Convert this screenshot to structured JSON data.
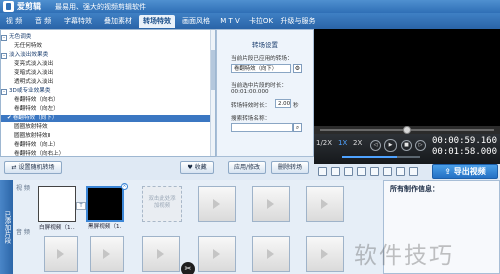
{
  "app": {
    "title": "爱剪辑",
    "slogan": "最易用、强大的视频剪辑软件"
  },
  "tabs": [
    {
      "label": "视 频",
      "active": false
    },
    {
      "label": "音 频",
      "active": false
    },
    {
      "label": "字幕特效",
      "active": false
    },
    {
      "label": "叠加素材",
      "active": false
    },
    {
      "label": "转场特效",
      "active": true
    },
    {
      "label": "画面风格",
      "active": false
    },
    {
      "label": "M T V",
      "active": false
    },
    {
      "label": "卡拉OK",
      "active": false
    },
    {
      "label": "升级与服务",
      "active": false
    }
  ],
  "tree": [
    {
      "label": "无色调类",
      "type": "group"
    },
    {
      "label": "无任何特效",
      "type": "item"
    },
    {
      "label": "淡入淡出效果类",
      "type": "group"
    },
    {
      "label": "变亮式淡入淡出",
      "type": "item"
    },
    {
      "label": "变暗式淡入淡出",
      "type": "item"
    },
    {
      "label": "透明式淡入淡出",
      "type": "item"
    },
    {
      "label": "3D或专业效果类",
      "type": "group"
    },
    {
      "label": "卷翻特效（向右）",
      "type": "item"
    },
    {
      "label": "卷翻特效（向左）",
      "type": "item"
    },
    {
      "label": "卷翻特效（向下）",
      "type": "item",
      "selected": true,
      "checked": true
    },
    {
      "label": "圆圈放射特效",
      "type": "item"
    },
    {
      "label": "圆圈放射特效Ⅱ",
      "type": "item"
    },
    {
      "label": "卷翻特效（向上）",
      "type": "item"
    },
    {
      "label": "卷翻特效（向右上）",
      "type": "item"
    }
  ],
  "settings": {
    "header": "转场设置",
    "current_label": "当前片段已应用的转场：",
    "current_value": "卷翻特效（向下）",
    "clip_length_label": "当前选中片段的时长：",
    "clip_length_value": "00:01:00.000",
    "duration_label": "转场特效时长：",
    "duration_value": "2.00",
    "duration_unit": "秒",
    "search_label": "搜索转场名称："
  },
  "actions": {
    "set_random": "设置随机转场",
    "favorite": "收藏",
    "apply": "应用/修改",
    "delete": "删除转场"
  },
  "player": {
    "speed_options": [
      "1/2X",
      "1X",
      "2X"
    ],
    "speed_active": "1X",
    "time_current": "00:00:59.160",
    "time_total": "00:01:58.000",
    "seek_fraction": 0.5,
    "volume_fraction": 0.7
  },
  "export_label": "导出视频",
  "timeline": {
    "side_tab": "已添加片段",
    "video_track_label": "视 频",
    "audio_track_label": "音 频",
    "clips": [
      {
        "label": "白屏视频（1…",
        "kind": "white"
      },
      {
        "label": "黑屏视频（1…",
        "kind": "black",
        "selected": true
      },
      {
        "label": "",
        "kind": "placeholder",
        "hint": "双击此处添加视频"
      }
    ],
    "transition_icon": "T",
    "cut_icon": "✂"
  },
  "info_panel": {
    "title": "所有制作信息："
  },
  "watermark": "软件技巧",
  "colors": {
    "accent": "#2f6fb6",
    "selection": "#3b77c2"
  }
}
